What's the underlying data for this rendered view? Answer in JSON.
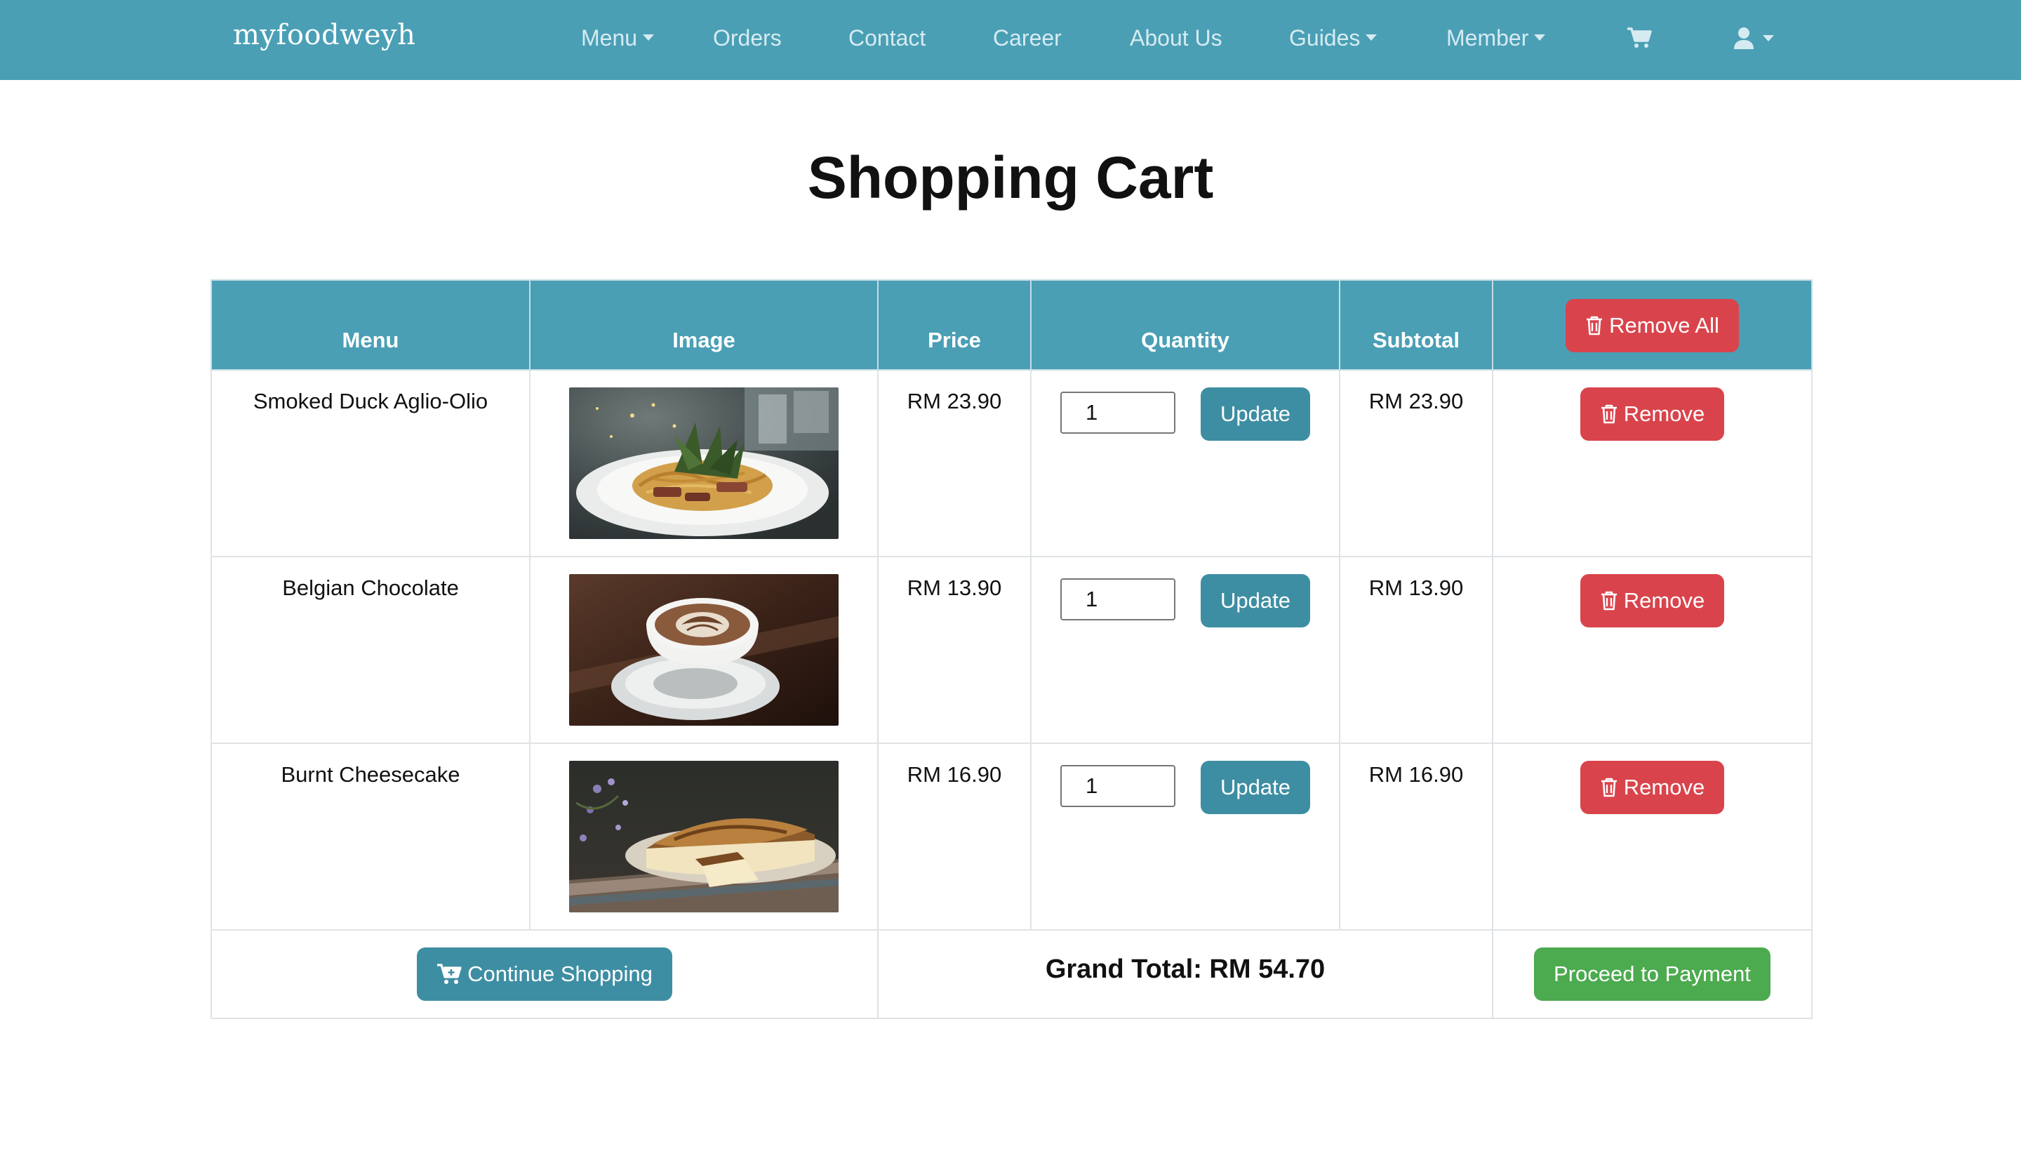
{
  "nav": {
    "brand": "myfoodweyh",
    "items": [
      "Menu",
      "Orders",
      "Contact",
      "Career",
      "About Us",
      "Guides",
      "Member"
    ],
    "icons": [
      "cart-icon",
      "user-icon"
    ]
  },
  "page": {
    "title": "Shopping Cart"
  },
  "table": {
    "headers": {
      "menu": "Menu",
      "image": "Image",
      "price": "Price",
      "quantity": "Quantity",
      "subtotal": "Subtotal",
      "remove_all": "Remove All"
    },
    "rows": [
      {
        "name": "Smoked Duck Aglio-Olio",
        "price": "RM 23.90",
        "qty": "1",
        "subtotal": "RM 23.90",
        "update": "Update",
        "remove": "Remove"
      },
      {
        "name": "Belgian Chocolate",
        "price": "RM 13.90",
        "qty": "1",
        "subtotal": "RM 13.90",
        "update": "Update",
        "remove": "Remove"
      },
      {
        "name": "Burnt Cheesecake",
        "price": "RM 16.90",
        "qty": "1",
        "subtotal": "RM 16.90",
        "update": "Update",
        "remove": "Remove"
      }
    ]
  },
  "footer": {
    "continue": "Continue Shopping",
    "grand_total": "Grand Total: RM 54.70",
    "proceed": "Proceed to Payment"
  },
  "colors": {
    "primary": "#4a9fb5",
    "button_teal": "#3e8ea3",
    "danger": "#d9444c",
    "success": "#4caa4f"
  }
}
